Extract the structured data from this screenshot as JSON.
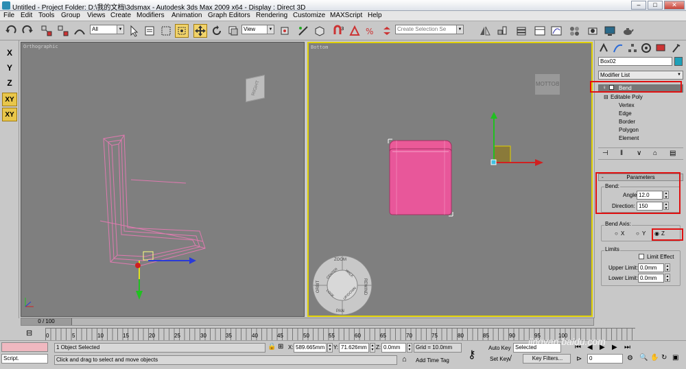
{
  "titlebar": {
    "title": "Untitled    - Project Folder: D:\\我的文档\\3dsmax    - Autodesk 3ds Max  2009 x64     - Display : Direct 3D",
    "minimize": "–",
    "maximize": "□",
    "close": "✕"
  },
  "menu": {
    "items": [
      "File",
      "Edit",
      "Tools",
      "Group",
      "Views",
      "Create",
      "Modifiers",
      "Animation",
      "Graph Editors",
      "Rendering",
      "Customize",
      "MAXScript",
      "Help"
    ]
  },
  "toolbar": {
    "selection_filter": "All",
    "reference_coord": "View",
    "named_selection_placeholder": "Create Selection Se"
  },
  "left_axis": {
    "x": "X",
    "y": "Y",
    "z": "Z",
    "xy": "XY",
    "xy2": "XY"
  },
  "viewports": {
    "left": {
      "label": "Orthographic",
      "cube_label": "RIGHT"
    },
    "right": {
      "label": "Bottom",
      "cube_label": "BOTTOM"
    }
  },
  "nav_wheel": {
    "zoom": "ZOOM",
    "orbit": "ORBIT",
    "center": "CENTER",
    "walk": "WALK",
    "rewind": "REWIND",
    "look": "LOOK",
    "updown": "UP/DOWN",
    "pan": "PAN"
  },
  "command_panel": {
    "object_name": "Box02",
    "object_color": "#1fa0b8",
    "modifier_list": "Modifier List",
    "stack": {
      "bend": "Bend",
      "editable_poly": "Editable Poly",
      "subobjects": [
        "Vertex",
        "Edge",
        "Border",
        "Polygon",
        "Element"
      ]
    },
    "parameters": {
      "rollout_title": "Parameters",
      "bend_group": "Bend:",
      "angle_label": "Angle:",
      "angle_value": "12.0",
      "direction_label": "Direction:",
      "direction_value": "150",
      "axis_group": "Bend Axis:",
      "axis_x": "X",
      "axis_y": "Y",
      "axis_z": "Z",
      "limits_group": "Limits",
      "limit_effect": "Limit Effect",
      "upper_label": "Upper Limit:",
      "upper_value": "0.0mm",
      "lower_label": "Lower Limit:",
      "lower_value": "0.0mm"
    }
  },
  "timeline": {
    "frame": "0 / 100",
    "ticks": [
      "0",
      "5",
      "10",
      "15",
      "20",
      "25",
      "30",
      "35",
      "40",
      "45",
      "50",
      "55",
      "60",
      "65",
      "70",
      "75",
      "80",
      "85",
      "90",
      "95",
      "100"
    ]
  },
  "status": {
    "selected": "1 Object Selected",
    "prompt": "Click and drag to select and move objects",
    "x_label": "X:",
    "x_value": "589.665mm",
    "y_label": "Y:",
    "y_value": "71.626mm",
    "z_label": "Z:",
    "z_value": "0.0mm",
    "grid": "Grid = 10.0mm",
    "add_time_tag": "Add Time Tag",
    "auto_key": "Auto Key",
    "auto_key_mode": "Selected",
    "set_key": "Set Key",
    "key_filters": "Key Filters...",
    "frame_field": "0",
    "script_label": "Script."
  },
  "watermark": "jingyan.baidu.com"
}
